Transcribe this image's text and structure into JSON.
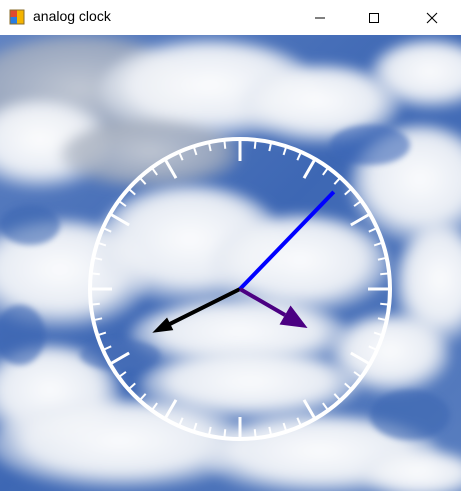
{
  "window": {
    "title": "analog clock",
    "app_icon": "windows-forms-app-icon",
    "controls": {
      "minimize": "minimize-icon",
      "maximize": "maximize-icon",
      "close": "close-icon"
    }
  },
  "clock": {
    "time": {
      "hours": 8,
      "minutes": 7,
      "seconds": 20
    },
    "colors": {
      "face": "#ffffff",
      "hour_hand": "#000000",
      "minute_hand": "#0000ff",
      "second_hand": "#4b0082"
    }
  },
  "background": {
    "description_color_sky": "#3b66b5",
    "description_color_cloud": "#f2f4f7"
  }
}
